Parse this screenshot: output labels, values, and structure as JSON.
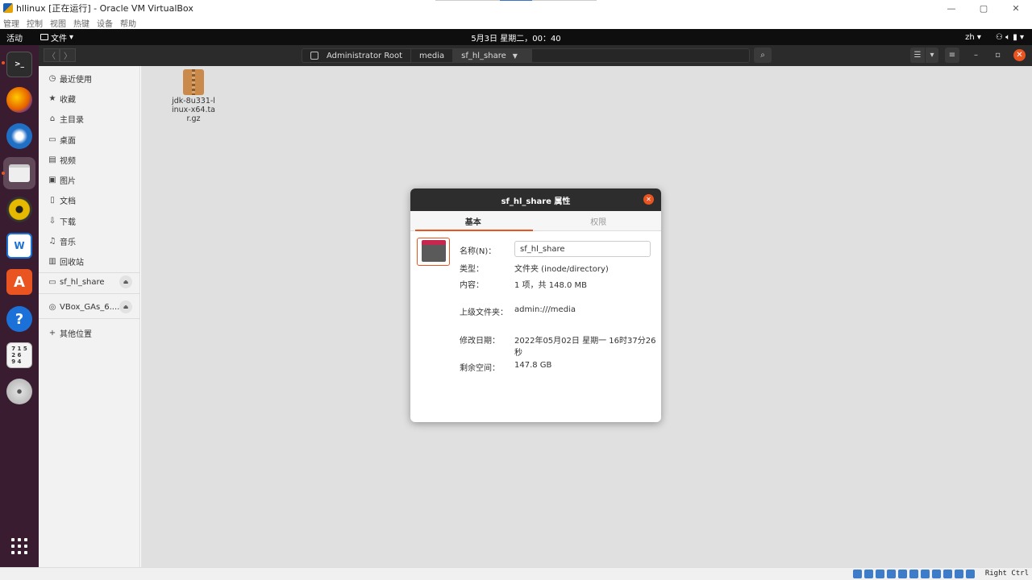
{
  "vbox": {
    "title": "hllinux [正在运行] - Oracle VM VirtualBox",
    "minimize": "—",
    "maximize": "▢",
    "close": "✕",
    "menu": [
      "管理",
      "控制",
      "视图",
      "热键",
      "设备",
      "帮助"
    ],
    "host_key": "Right Ctrl"
  },
  "topbar": {
    "activities": "活动",
    "files_menu": "文件",
    "clock": "5月3日 星期二，00：40",
    "lang": "zh"
  },
  "header": {
    "back": "〈",
    "forward": "〉",
    "breadcrumbs": [
      "Administrator Root",
      "media",
      "sf_hl_share"
    ],
    "dropdown": "▼",
    "search_icon": "⌕",
    "view_list": "☰",
    "view_dropdown": "▾",
    "menu": "≡",
    "minimize": "–",
    "restore": "▫",
    "close": "✕"
  },
  "sidebar": {
    "items": [
      {
        "icon": "◷",
        "label": "最近使用"
      },
      {
        "icon": "★",
        "label": "收藏"
      },
      {
        "icon": "⌂",
        "label": "主目录"
      },
      {
        "icon": "▭",
        "label": "桌面"
      },
      {
        "icon": "▤",
        "label": "视频"
      },
      {
        "icon": "▣",
        "label": "图片"
      },
      {
        "icon": "▯",
        "label": "文档"
      },
      {
        "icon": "⇩",
        "label": "下载"
      },
      {
        "icon": "♫",
        "label": "音乐"
      },
      {
        "icon": "▥",
        "label": "回收站"
      }
    ],
    "mounts": [
      {
        "label": "sf_hl_share",
        "eject": "⏏"
      },
      {
        "label": "VBox_GAs_6....",
        "eject": "⏏"
      }
    ],
    "other": {
      "icon": "+",
      "label": "其他位置"
    }
  },
  "content": {
    "file_name": "jdk-8u331-linux-x64.tar.gz"
  },
  "dialog": {
    "title": "sf_hl_share 属性",
    "close": "✕",
    "tabs": [
      "基本",
      "权限"
    ],
    "name_label": "名称(N)：",
    "name_value": "sf_hl_share",
    "rows": [
      {
        "label": "类型：",
        "value": "文件夹 (inode/directory)"
      },
      {
        "label": "内容：",
        "value": "1 项，共 148.0 MB"
      },
      {
        "label": "上级文件夹：",
        "value": "admin:///media"
      },
      {
        "label": "修改日期：",
        "value": "2022年05月02日 星期一 16时37分26秒"
      },
      {
        "label": "剩余空间：",
        "value": "147.8 GB"
      }
    ]
  },
  "colors": {
    "accent": "#e95420",
    "dock": "#3a1c31",
    "topbar": "#0e0e0e"
  }
}
